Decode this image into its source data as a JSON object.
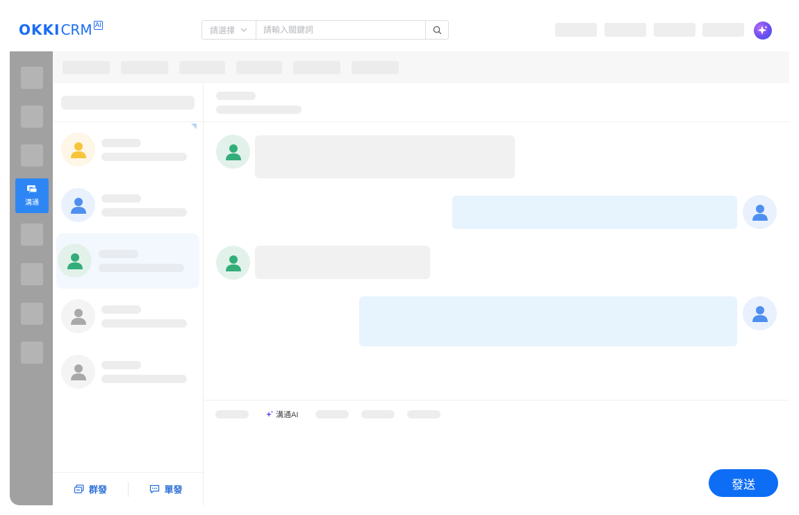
{
  "header": {
    "logo": {
      "okki": "OKKI",
      "crm": "CRM",
      "ai": "AI"
    },
    "search": {
      "select_label": "請選擇",
      "placeholder": "請輸入關鍵詞"
    }
  },
  "rail": {
    "active_label": "溝通"
  },
  "list": {
    "footer": {
      "group_send": "群發",
      "single_send": "單發"
    }
  },
  "composer": {
    "ai_label": "溝通AI",
    "send_label": "發送"
  },
  "colors": {
    "accent": "#0d6df5",
    "rail_bg": "#a1a1a1",
    "bubble_out": "#e7f3fd",
    "bubble_in": "#f1f1f1",
    "avatar_yellow": "#f7c53b",
    "avatar_blue": "#4e8ff0",
    "avatar_green": "#33ad7a",
    "avatar_gray": "#a9a9a9"
  }
}
